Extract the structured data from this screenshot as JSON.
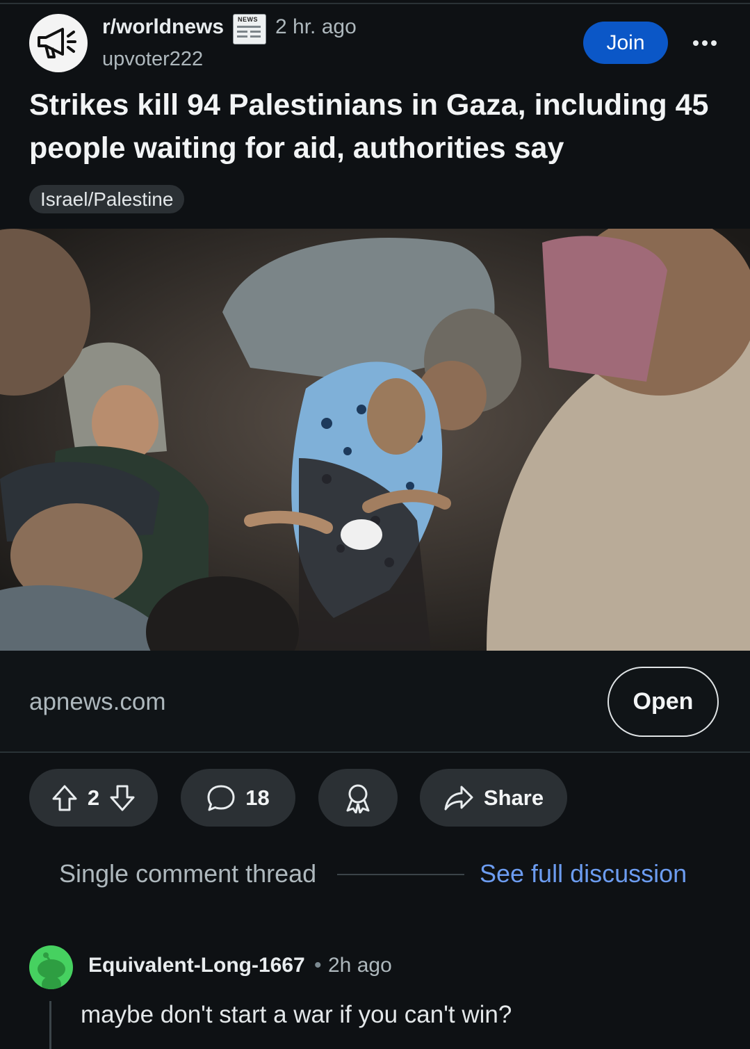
{
  "post": {
    "subreddit": "r/worldnews",
    "subreddit_badge": "NEWS",
    "time": "2 hr. ago",
    "author": "upvoter222",
    "join_label": "Join",
    "title": "Strikes kill 94 Palestinians in Gaza, including 45 people waiting for aid, authorities say",
    "flair": "Israel/Palestine",
    "link_domain": "apnews.com",
    "open_label": "Open"
  },
  "actions": {
    "vote_count": "2",
    "comment_count": "18",
    "share_label": "Share"
  },
  "thread": {
    "label": "Single comment thread",
    "full_discussion_label": "See full discussion"
  },
  "comment": {
    "username": "Equivalent-Long-1667",
    "separator": "•",
    "time": "2h ago",
    "body": "maybe don't start a war if you can't win?"
  },
  "colors": {
    "background": "#0e1114",
    "join_button": "#0b57c7",
    "link_blue": "#6c9cf0",
    "pill": "#2b3034",
    "comment_avatar": "#46d160"
  },
  "icons": {
    "subreddit": "megaphone-icon",
    "upvote": "arrow-up-icon",
    "downvote": "arrow-down-icon",
    "comment": "speech-bubble-icon",
    "award": "award-icon",
    "share": "share-arrow-icon",
    "more": "more-dots-icon"
  }
}
